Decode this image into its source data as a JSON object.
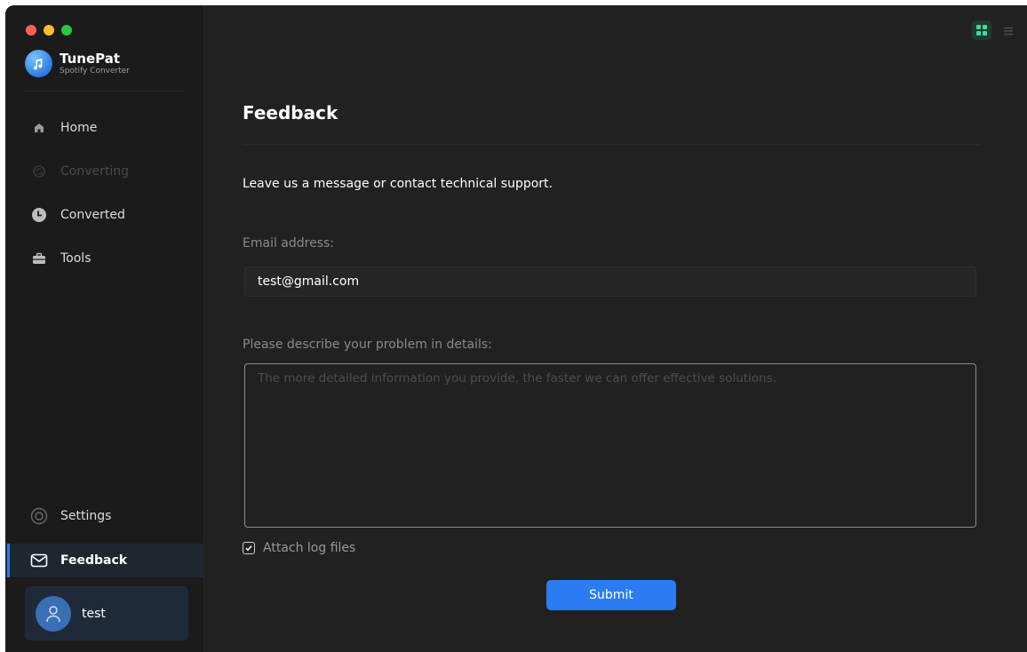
{
  "app": {
    "name": "TunePat",
    "subtitle": "Spotify Converter"
  },
  "sidebar": {
    "items": [
      {
        "label": "Home",
        "icon": "home-icon",
        "state": "normal"
      },
      {
        "label": "Converting",
        "icon": "converting-icon",
        "state": "disabled"
      },
      {
        "label": "Converted",
        "icon": "clock-icon",
        "state": "normal"
      },
      {
        "label": "Tools",
        "icon": "toolbox-icon",
        "state": "normal"
      }
    ],
    "bottom_items": [
      {
        "label": "Settings",
        "icon": "gear-icon",
        "state": "normal"
      },
      {
        "label": "Feedback",
        "icon": "mail-icon",
        "state": "active"
      }
    ],
    "user": {
      "name": "test",
      "icon": "user-icon"
    }
  },
  "toolbar": {
    "icons": [
      "theme-toggle-icon",
      "menu-icon"
    ]
  },
  "feedback": {
    "title": "Feedback",
    "intro": "Leave us a message or contact technical support.",
    "email_label": "Email address:",
    "email_value": "test@gmail.com",
    "problem_label": "Please describe your problem in details:",
    "problem_placeholder": "The more detailed information you provide, the faster we can offer effective solutions.",
    "attach_label": "Attach log files",
    "attach_checked": true,
    "submit_label": "Submit"
  },
  "colors": {
    "accent": "#2b7cf2",
    "background": "#212121",
    "sidebar": "#1b1b1b"
  }
}
